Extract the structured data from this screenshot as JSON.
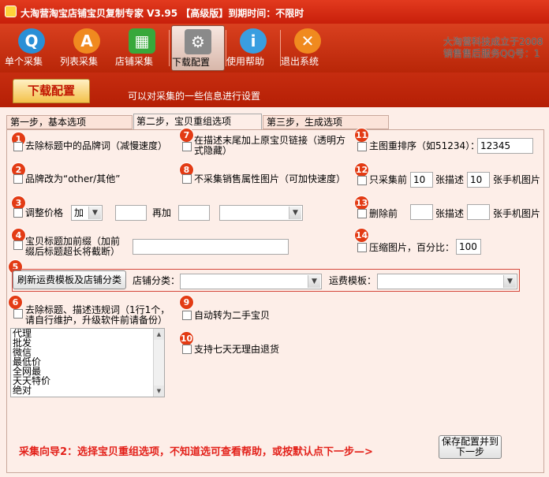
{
  "window": {
    "title": "大淘营淘宝店铺宝贝复制专家 V3.95 【高级版】到期时间：不限时"
  },
  "toolbar": {
    "items": [
      {
        "label": "单个采集",
        "icon": "q-magnifier-icon",
        "color": "#2a8fd6"
      },
      {
        "label": "列表采集",
        "icon": "a-triangle-icon",
        "color": "#f08a1f"
      },
      {
        "label": "店铺采集",
        "icon": "store-icon",
        "color": "#38a83b"
      },
      {
        "label": "下载配置",
        "icon": "settings-doc-icon",
        "color": "#7a7a7a"
      },
      {
        "label": "使用帮助",
        "icon": "info-icon",
        "color": "#3a9ee0"
      },
      {
        "label": "退出系统",
        "icon": "close-icon",
        "color": "#f08a1f"
      }
    ],
    "corner_line1": "大淘营科技成立于2008",
    "corner_line2": "销售售后服务QQ号：1"
  },
  "header": {
    "tab": "下载配置",
    "desc": "可以对采集的一些信息进行设置"
  },
  "steps": {
    "s1": "第一步，基本选项",
    "s2": "第二步，宝贝重组选项",
    "s3": "第三步，生成选项"
  },
  "options": {
    "o1": "去除标题中的品牌词（减慢速度）",
    "o2": "品牌改为“other/其他”",
    "o3": "调整价格",
    "o3_op": "加",
    "o3_again": "再加",
    "o4_line1": "宝贝标题加前缀（加前",
    "o4_line2": "缀后标题超长将截断）",
    "o5_button": "刷新运费模板及店铺分类",
    "o5_shop_cat": "店铺分类：",
    "o5_ship_tpl": "运费模板：",
    "o6_line1": "去除标题、描述违规词（1行1个，",
    "o6_line2": "请自行维护，升级软件前请备份）",
    "o6_words": [
      "代理",
      "批发",
      "微信",
      "最低价",
      "全网最",
      "天天特价",
      "绝对"
    ],
    "o7_line1": "在描述末尾加上原宝贝链接（透明方",
    "o7_line2": "式隐藏）",
    "o8": "不采集销售属性图片（可加快速度）",
    "o9": "自动转为二手宝贝",
    "o10": "支持七天无理由退货",
    "o11": "主图重排序（如51234）：",
    "o11_value": "12345",
    "o12": "只采集前",
    "o12_v1": "10",
    "o12_mid": "张描述",
    "o12_v2": "10",
    "o12_end": "张手机图片",
    "o13": "删除前",
    "o13_mid": "张描述",
    "o13_end": "张手机图片",
    "o14": "压缩图片，百分比：",
    "o14_value": "100"
  },
  "badges": [
    "1",
    "2",
    "3",
    "4",
    "5",
    "6",
    "7",
    "8",
    "9",
    "10",
    "11",
    "12",
    "13",
    "14"
  ],
  "footer": {
    "guide": "采集向导2：选择宝贝重组选项，不知道选可查看帮助，或按默认点下一步—>",
    "save_line1": "保存配置并到",
    "save_line2": "下一步"
  }
}
